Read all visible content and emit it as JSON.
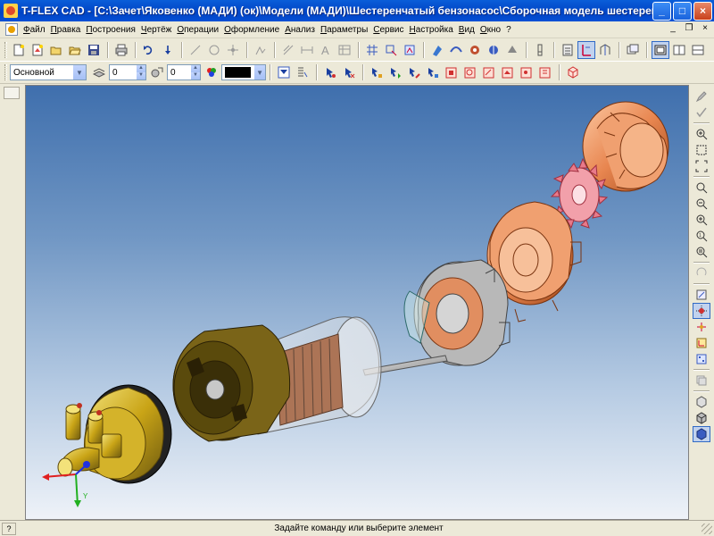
{
  "window": {
    "title": "T-FLEX CAD - [C:\\Зачет\\Яковенко (МАДИ) (ок)\\Модели (МАДИ)\\Шестеренчатый бензонасос\\Сборочная модель шестеренчатого насоса.grb]",
    "minimize": "_",
    "maximize": "□",
    "close": "×"
  },
  "menu": {
    "items": [
      "Файл",
      "Правка",
      "Построения",
      "Чертёж",
      "Операции",
      "Оформление",
      "Анализ",
      "Параметры",
      "Сервис",
      "Настройка",
      "Вид",
      "Окно",
      "?"
    ],
    "mdi": {
      "minimize": "_",
      "restore": "❐",
      "close": "×"
    }
  },
  "toolbar2": {
    "layer_value": "Основной",
    "level_value": "0",
    "priority_value": "0"
  },
  "colors": {
    "titlebar": "#0a5ed9",
    "viewport_top": "#3f6fad",
    "viewport_bottom": "#eef2f8",
    "part_yellow": "#c9a416",
    "part_orange": "#e88650",
    "part_pink": "#e87a8a",
    "part_olive": "#6e5a10",
    "axis_x": "#e02020",
    "axis_y": "#20b020",
    "axis_z": "#2030e0"
  },
  "status": {
    "left_label": "?",
    "message": "Задайте команду или выберите элемент"
  },
  "icons": {
    "toolbar1": [
      "new-file-icon",
      "new-3d-icon",
      "open-icon",
      "open-folder-icon",
      "save-icon",
      "print-icon",
      "undo-icon",
      "redo-icon",
      "line-icon",
      "circle-icon",
      "node-icon",
      "sketch-icon",
      "hatch-icon",
      "dimension-icon",
      "text-icon",
      "table-icon",
      "grid-icon",
      "projection-icon",
      "view-icon",
      "hole-icon",
      "pipe-icon",
      "rotate-icon",
      "extrude-icon",
      "revolve-icon",
      "fillet-icon",
      "shell-icon",
      "section-icon",
      "calculator-icon",
      "measure-icon",
      "model-icon",
      "window-icon",
      "window-active-icon"
    ],
    "right": [
      "pencil-icon",
      "check-icon",
      "zoom-in-icon",
      "zoom-window-icon",
      "fit-all-icon",
      "zoom-out-icon",
      "zoom-prev-icon",
      "zoom-next-icon",
      "zoom-real-icon",
      "zoom-fit-icon",
      "rotate-view-icon",
      "render-icon",
      "snap-icon",
      "coordinate-icon",
      "axis-icon",
      "pattern-icon",
      "layers-icon",
      "light-icon",
      "material-icon",
      "camera-icon",
      "shade-icon"
    ]
  }
}
